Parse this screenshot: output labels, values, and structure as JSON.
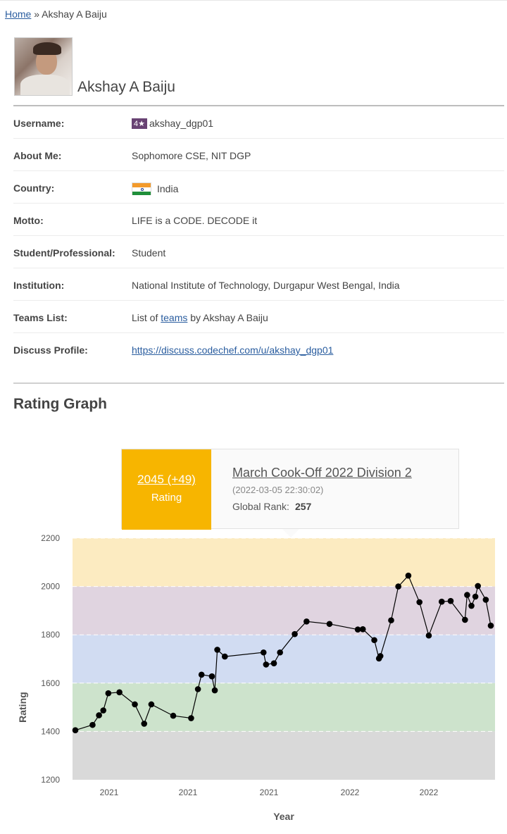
{
  "breadcrumb": {
    "home": "Home",
    "separator": "»",
    "current": "Akshay A Baiju"
  },
  "profile": {
    "name": "Akshay A Baiju"
  },
  "info": {
    "username_label": "Username:",
    "username_stars": "4★",
    "username": "akshay_dgp01",
    "about_label": "About Me:",
    "about": "Sophomore CSE, NIT DGP",
    "country_label": "Country:",
    "country": "India",
    "motto_label": "Motto:",
    "motto": "LIFE is a CODE. DECODE it",
    "student_label": "Student/Professional:",
    "student": "Student",
    "institution_label": "Institution:",
    "institution": "National Institute of Technology, Durgapur West Bengal, India",
    "teams_label": "Teams List:",
    "teams_prefix": "List of",
    "teams_link": "teams",
    "teams_suffix": "by Akshay A Baiju",
    "discuss_label": "Discuss Profile:",
    "discuss_link": "https://discuss.codechef.com/u/akshay_dgp01"
  },
  "rating_graph": {
    "title": "Rating Graph",
    "tooltip": {
      "rating": "2045 (+49)",
      "rating_label": "Rating",
      "contest": "March Cook-Off 2022 Division 2",
      "date": "(2022-03-05 22:30:02)",
      "rank_label": "Global Rank:",
      "rank": "257"
    }
  },
  "colors": {
    "band_2000": "#fcebc1",
    "band_1800": "#e0d4e0",
    "band_1600": "#d1dcf2",
    "band_1400": "#cde3cc",
    "band_low": "#d9d9d9",
    "tooltip_accent": "#f7b500",
    "link": "#2a5d9f"
  },
  "chart_data": {
    "type": "line",
    "xlabel": "Year",
    "ylabel": "Rating",
    "ylim": [
      1200,
      2200
    ],
    "yticks": [
      1200,
      1400,
      1600,
      1800,
      2000,
      2200
    ],
    "xtick_labels": [
      "2021",
      "2021",
      "2021",
      "2022",
      "2022"
    ],
    "bands": [
      {
        "from": 2000,
        "to": 2200,
        "color": "#fcebc1"
      },
      {
        "from": 1800,
        "to": 2000,
        "color": "#e0d4e0"
      },
      {
        "from": 1600,
        "to": 1800,
        "color": "#d1dcf2"
      },
      {
        "from": 1400,
        "to": 1600,
        "color": "#cde3cc"
      },
      {
        "from": 1200,
        "to": 1400,
        "color": "#d9d9d9"
      }
    ],
    "series": [
      {
        "index": [
          0,
          4.8,
          6.6,
          7.8,
          9.2,
          12.3,
          16.6,
          19.2,
          21.2,
          27.3,
          32.3,
          34.2,
          35.2,
          38.1,
          38.9,
          39.6,
          41.7,
          52.5,
          53.2,
          55.4,
          57.1,
          61.2,
          64.5,
          70.9,
          78.8,
          80.2,
          83.4,
          84.7,
          85.1,
          88.1,
          90.1,
          92.9,
          96.0,
          98.6,
          102.2,
          104.7,
          108.7,
          109.3,
          110.5,
          111.6,
          112.3,
          114.5,
          115.9
        ],
        "values": [
          1405,
          1427,
          1467,
          1487,
          1558,
          1562,
          1512,
          1432,
          1512,
          1465,
          1455,
          1575,
          1635,
          1628,
          1570,
          1738,
          1710,
          1727,
          1677,
          1682,
          1727,
          1803,
          1855,
          1845,
          1822,
          1823,
          1778,
          1702,
          1712,
          1860,
          2000,
          2045,
          1935,
          1797,
          1937,
          1940,
          1862,
          1965,
          1920,
          1958,
          2002,
          1945,
          1838
        ]
      }
    ]
  }
}
